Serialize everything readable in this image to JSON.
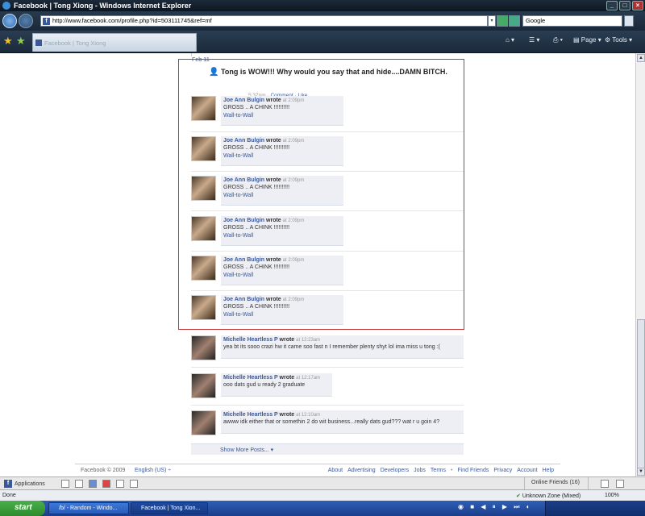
{
  "window": {
    "title": "Facebook | Tong Xiong - Windows Internet Explorer",
    "controls": [
      "_",
      "□",
      "×"
    ]
  },
  "toolbar": {
    "url": "http://www.facebook.com/profile.php?id=503111745&ref=mf",
    "search_placeholder": "Google",
    "tab_title": "Facebook | Tong Xiong",
    "page_menu": "Page",
    "tools_menu": "Tools"
  },
  "feed": {
    "date": "Feb 11",
    "status_text": "Tong is WOW!!! Why would you say that and hide....DAMN BITCH.",
    "status_time": "5:37pm",
    "status_comment": "Comment",
    "status_like": "Like",
    "dot": " · ",
    "posts": [
      {
        "author": "Joe Ann Bulgin",
        "wrote": "wrote",
        "time": "at 2:09pm",
        "text": "GROSS .. A CHINK !!!!!!!!!!",
        "link": "Wall-to-Wall"
      },
      {
        "author": "Joe Ann Bulgin",
        "wrote": "wrote",
        "time": "at 2:09pm",
        "text": "GROSS .. A CHINK !!!!!!!!!!",
        "link": "Wall-to-Wall"
      },
      {
        "author": "Joe Ann Bulgin",
        "wrote": "wrote",
        "time": "at 2:09pm",
        "text": "GROSS .. A CHINK !!!!!!!!!!",
        "link": "Wall-to-Wall"
      },
      {
        "author": "Joe Ann Bulgin",
        "wrote": "wrote",
        "time": "at 2:09pm",
        "text": "GROSS .. A CHINK !!!!!!!!!!",
        "link": "Wall-to-Wall"
      },
      {
        "author": "Joe Ann Bulgin",
        "wrote": "wrote",
        "time": "at 2:09pm",
        "text": "GROSS .. A CHINK !!!!!!!!!!",
        "link": "Wall-to-Wall"
      },
      {
        "author": "Joe Ann Bulgin",
        "wrote": "wrote",
        "time": "at 2:09pm",
        "text": "GROSS .. A CHINK !!!!!!!!!!",
        "link": "Wall-to-Wall"
      },
      {
        "author": "Michelle Heartless P",
        "wrote": "wrote",
        "time": "at 12:23am",
        "text": "yea bt its sooo crazi hw it came soo fast n I remember plenty shyt lol ima miss u tong :(",
        "link": ""
      },
      {
        "author": "Michelle Heartless P",
        "wrote": "wrote",
        "time": "at 12:17am",
        "text": "ooo dats gud u ready 2 graduate",
        "link": ""
      },
      {
        "author": "Michelle Heartless P",
        "wrote": "wrote",
        "time": "at 12:10am",
        "text": "awww idk either that or somethin 2 do wit business...really dats gud??? wat r u goin 4?",
        "link": ""
      }
    ],
    "show_more": "Show More Posts... ▾"
  },
  "footer": {
    "copyright": "Facebook © 2009",
    "language": "English (US) ÷",
    "links": [
      "About",
      "Advertising",
      "Developers",
      "Jobs",
      "Terms",
      "•",
      "Find Friends",
      "Privacy",
      "Account",
      "Help"
    ]
  },
  "chatbar": {
    "applications": "Applications",
    "online_friends": "Online Friends (16)"
  },
  "statusbar": {
    "done": "Done",
    "zone": "Unknown Zone (Mixed)",
    "zoom": "100%"
  },
  "taskbar": {
    "start": "start",
    "tasks": [
      "/b/ - Random - Windo...",
      "Facebook | Tong Xion..."
    ]
  },
  "colors": {
    "fb_blue": "#3b5998",
    "highlight_border": "#c03535",
    "bubble_bg": "#edeff4"
  }
}
